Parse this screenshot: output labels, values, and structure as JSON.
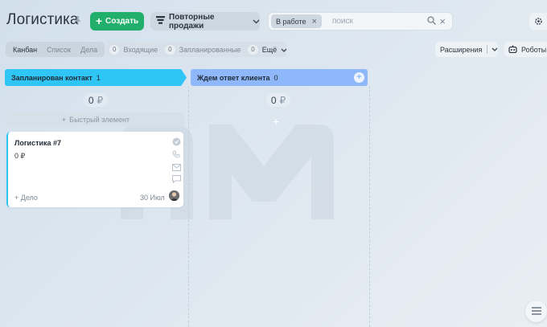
{
  "header": {
    "title": "Логистика",
    "create_label": "Создать",
    "repeat_sales_label": "Повторные продажи",
    "search": {
      "chip_label": "В работе",
      "placeholder": "поиск"
    }
  },
  "toolbar": {
    "view_tabs": [
      "Канбан",
      "Список",
      "Дела"
    ],
    "counters": [
      {
        "count": "0",
        "label": "Входящие"
      },
      {
        "count": "0",
        "label": "Запланированные"
      },
      {
        "count": "0",
        "label": "Ещё"
      }
    ],
    "extensions_label": "Расширения",
    "robots_label": "Роботы"
  },
  "columns": [
    {
      "title": "Запланирован контакт",
      "count": "1",
      "sum": "0",
      "currency": "₽",
      "color": "#2fc6f6",
      "quick_add_label": "Быстрый элемент"
    },
    {
      "title": "Ждем ответ клиента",
      "count": "0",
      "sum": "0",
      "currency": "₽",
      "color": "#8fb8fa"
    }
  ],
  "card": {
    "title": "Логистика #7",
    "price": "0 ₽",
    "activity_label": "+ Дело",
    "date": "30 Июл"
  },
  "colors": {
    "accent_green": "#22ae6b",
    "column1": "#2fc6f6",
    "column2": "#8fb8fa"
  }
}
